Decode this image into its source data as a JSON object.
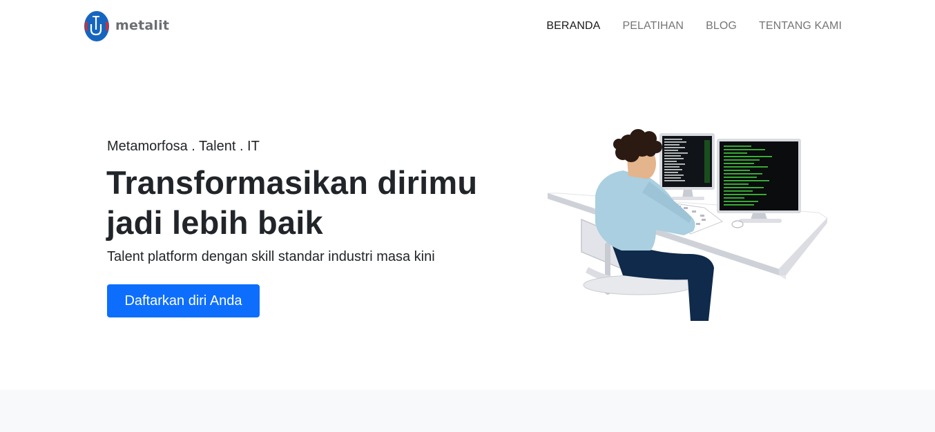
{
  "brand": {
    "name": "metalit",
    "logo_icon": "metalit-logo-icon"
  },
  "nav": {
    "items": [
      {
        "label": "BERANDA",
        "active": true
      },
      {
        "label": "PELATIHAN",
        "active": false
      },
      {
        "label": "BLOG",
        "active": false
      },
      {
        "label": "TENTANG KAMI",
        "active": false
      }
    ]
  },
  "hero": {
    "tagline": "Metamorfosa . Talent . IT",
    "title_line1": "Transformasikan dirimu",
    "title_line2": "jadi lebih baik",
    "lead": "Talent platform dengan skill standar industri masa kini",
    "cta_label": "Daftarkan diri Anda"
  },
  "colors": {
    "primary": "#0d6efd",
    "logo_blue": "#1565c0",
    "logo_red": "#d32f2f",
    "section_bg": "#f8f9fa"
  }
}
